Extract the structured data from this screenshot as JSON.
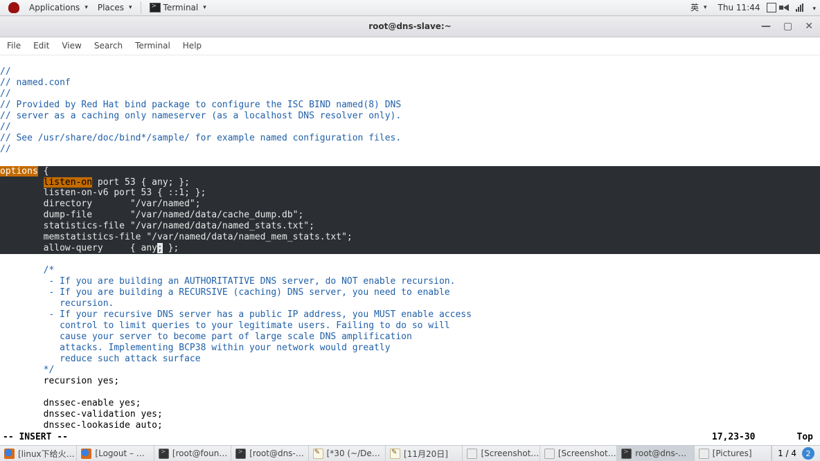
{
  "panel": {
    "applications": "Applications",
    "places": "Places",
    "terminal": "Terminal",
    "ime": "英",
    "clock": "Thu 11:44"
  },
  "window": {
    "title": "root@dns-slave:~",
    "menus": [
      "File",
      "Edit",
      "View",
      "Search",
      "Terminal",
      "Help"
    ]
  },
  "code": {
    "c1": "//",
    "c2": "// named.conf",
    "c3": "//",
    "c4": "// Provided by Red Hat bind package to configure the ISC BIND named(8) DNS",
    "c5": "// server as a caching only nameserver (as a localhost DNS resolver only).",
    "c6": "//",
    "c7": "// See /usr/share/doc/bind*/sample/ for example named configuration files.",
    "c8": "//",
    "blank1": "",
    "opt_kw": "options",
    "opt_rest": " {",
    "b1_pre": "        ",
    "b1_kw": "listen-on",
    "b1_rest": " port 53 { any; };",
    "b2": "        listen-on-v6 port 53 { ::1; };",
    "b3": "        directory       \"/var/named\";",
    "b4": "        dump-file       \"/var/named/data/cache_dump.db\";",
    "b5": "        statistics-file \"/var/named/data/named_stats.txt\";",
    "b6": "        memstatistics-file \"/var/named/data/named_mem_stats.txt\";",
    "b7_pre": "        allow-query     { any",
    "b7_cur": ";",
    "b7_post": " };",
    "blank2": "",
    "d1": "        /* ",
    "d2": "         - If you are building an AUTHORITATIVE DNS server, do NOT enable recursion.",
    "d3": "         - If you are building a RECURSIVE (caching) DNS server, you need to enable ",
    "d4": "           recursion. ",
    "d5": "         - If your recursive DNS server has a public IP address, you MUST enable access ",
    "d6": "           control to limit queries to your legitimate users. Failing to do so will",
    "d7": "           cause your server to become part of large scale DNS amplification ",
    "d8": "           attacks. Implementing BCP38 within your network would greatly",
    "d9": "           reduce such attack surface ",
    "d10": "        */",
    "r1": "        recursion yes;",
    "blank3": "",
    "r2": "        dnssec-enable yes;",
    "r3": "        dnssec-validation yes;",
    "r4": "        dnssec-lookaside auto;"
  },
  "status": {
    "mode": "-- INSERT --",
    "pos": "17,23-30",
    "scroll": "Top"
  },
  "tasks": [
    {
      "icon": "ff",
      "label": "[linux下给火…"
    },
    {
      "icon": "ff",
      "label": "[Logout – …"
    },
    {
      "icon": "tt",
      "label": "[root@foun…"
    },
    {
      "icon": "tt",
      "label": "[root@dns-…"
    },
    {
      "icon": "ge",
      "label": "[*30 (~/De…"
    },
    {
      "icon": "ge",
      "label": "[11月20日]"
    },
    {
      "icon": "fm",
      "label": "[Screenshot…"
    },
    {
      "icon": "fm",
      "label": "[Screenshot…"
    },
    {
      "icon": "tt",
      "label": "root@dns-…",
      "active": true
    },
    {
      "icon": "fm",
      "label": "[Pictures]"
    }
  ],
  "workspace": {
    "label": "1 / 4",
    "badge": "2"
  }
}
